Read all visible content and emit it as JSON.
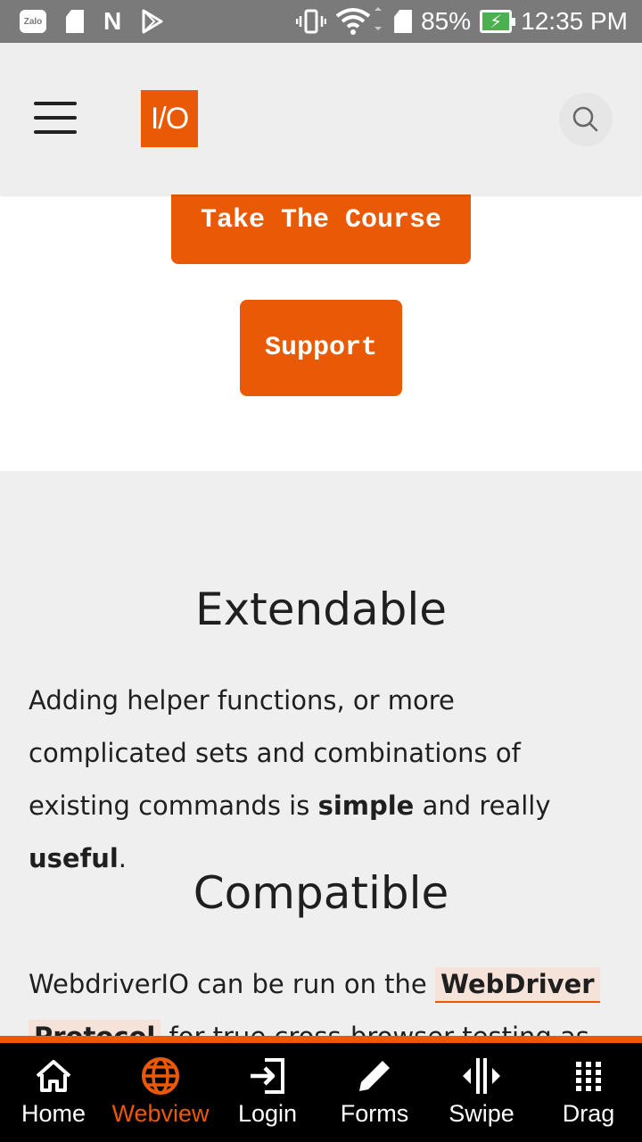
{
  "status_bar": {
    "battery": "85%",
    "time": "12:35 PM",
    "notification_icons": [
      "zalo-icon",
      "sd-card-icon",
      "n-app-icon",
      "play-store-icon"
    ],
    "zalo_label": "Zalo"
  },
  "header": {
    "logo_text": "I/O"
  },
  "hero": {
    "course_button": "Take The Course",
    "support_button": "Support"
  },
  "sections": {
    "extendable": {
      "title": "Extendable",
      "text_1": "Adding helper functions, or more complicated sets and combinations of existing commands is ",
      "bold_1": "simple",
      "text_2": " and really ",
      "bold_2": "useful",
      "text_3": "."
    },
    "compatible": {
      "title": "Compatible",
      "text_1": "WebdriverIO can be run on the ",
      "link_1": "WebDriver",
      "link_2": "Protocol",
      "text_2": " for true cross-browser testing as"
    }
  },
  "bottom_nav": {
    "tabs": [
      {
        "label": "Home",
        "icon": "home-icon"
      },
      {
        "label": "Webview",
        "icon": "globe-icon",
        "active": true
      },
      {
        "label": "Login",
        "icon": "login-icon"
      },
      {
        "label": "Forms",
        "icon": "pencil-icon"
      },
      {
        "label": "Swipe",
        "icon": "swipe-icon"
      },
      {
        "label": "Drag",
        "icon": "grid-icon"
      }
    ]
  },
  "colors": {
    "accent": "#ea5906",
    "status_bar": "#7a7a7a",
    "header_bg": "#eeeeee",
    "section_bg": "#efefef",
    "nav_bg": "#000000"
  }
}
